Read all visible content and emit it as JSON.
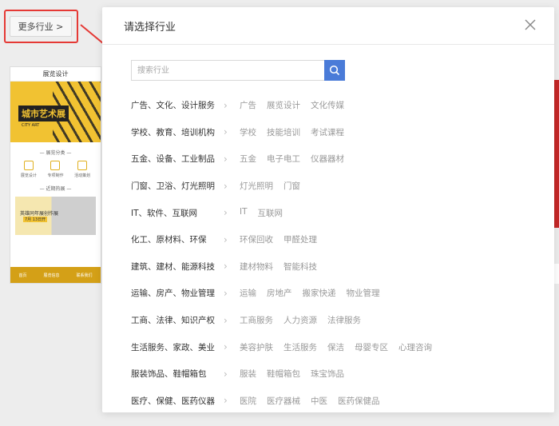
{
  "background": {
    "more_industries_button": "更多行业 >",
    "template_card": {
      "title": "展览设计",
      "banner_logo": "城市艺术展",
      "banner_sub": "CITY ART",
      "section1": "— 展览分类 —",
      "icons": [
        "展览设计",
        "专项制作",
        "活动策划"
      ],
      "section2": "— 近期热展 —",
      "featured_text": "英雄同年展创作展",
      "featured_date": "7月 13日开",
      "footer": [
        "首页",
        "展览信息",
        "联系我们"
      ]
    },
    "accent_color": "#f1c232",
    "highlight_color": "#e53935"
  },
  "modal": {
    "title": "请选择行业",
    "search_placeholder": "搜索行业",
    "search_value": "",
    "primary_color": "#4a7bd8",
    "categories": [
      {
        "name": "广告、文化、设计服务",
        "tags": [
          "广告",
          "展览设计",
          "文化传媒"
        ]
      },
      {
        "name": "学校、教育、培训机构",
        "tags": [
          "学校",
          "技能培训",
          "考试课程"
        ]
      },
      {
        "name": "五金、设备、工业制品",
        "tags": [
          "五金",
          "电子电工",
          "仪器器材"
        ]
      },
      {
        "name": "门窗、卫浴、灯光照明",
        "tags": [
          "灯光照明",
          "门窗"
        ]
      },
      {
        "name": "IT、软件、互联网",
        "tags": [
          "IT",
          "互联网"
        ]
      },
      {
        "name": "化工、原材料、环保",
        "tags": [
          "环保回收",
          "甲醛处理"
        ]
      },
      {
        "name": "建筑、建材、能源科技",
        "tags": [
          "建材物料",
          "智能科技"
        ]
      },
      {
        "name": "运输、房产、物业管理",
        "tags": [
          "运输",
          "房地产",
          "搬家快递",
          "物业管理"
        ]
      },
      {
        "name": "工商、法律、知识产权",
        "tags": [
          "工商服务",
          "人力资源",
          "法律服务"
        ]
      },
      {
        "name": "生活服务、家政、美业",
        "tags": [
          "美容护肤",
          "生活服务",
          "保洁",
          "母婴专区",
          "心理咨询"
        ]
      },
      {
        "name": "服装饰品、鞋帽箱包",
        "tags": [
          "服装",
          "鞋帽箱包",
          "珠宝饰品"
        ]
      },
      {
        "name": "医疗、保健、医药仪器",
        "tags": [
          "医院",
          "医疗器械",
          "中医",
          "医药保健品"
        ]
      }
    ]
  }
}
